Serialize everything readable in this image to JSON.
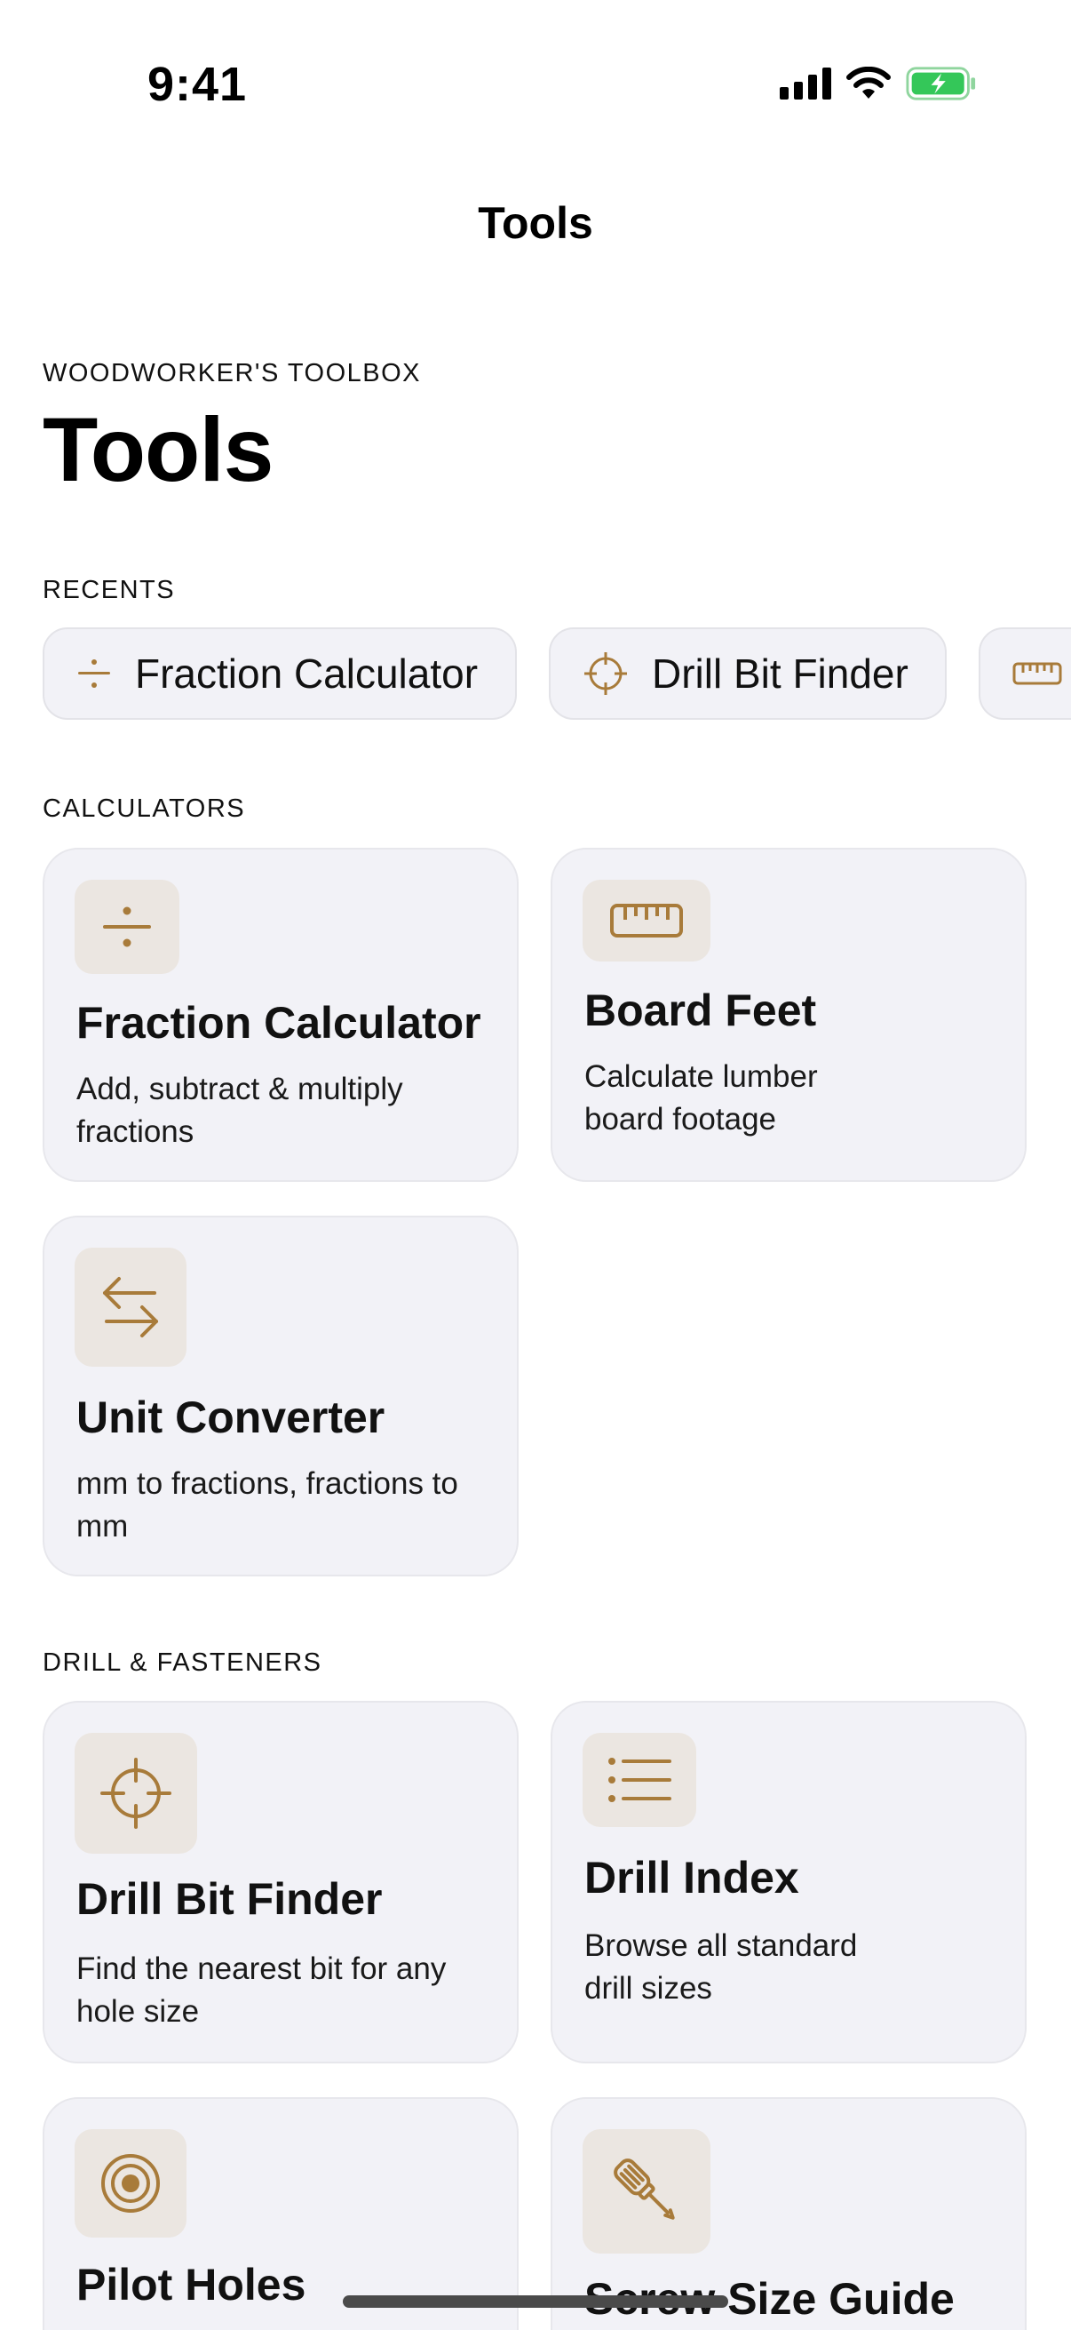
{
  "status_bar": {
    "time": "9:41"
  },
  "nav": {
    "title": "Tools"
  },
  "header": {
    "eyebrow": "WOODWORKER'S TOOLBOX",
    "title": "Tools"
  },
  "recents": {
    "section_label": "RECENTS",
    "items": [
      {
        "label": "Fraction Calculator",
        "icon": "divide-icon"
      },
      {
        "label": "Drill Bit Finder",
        "icon": "crosshair-icon"
      },
      {
        "label": "",
        "icon": "ruler-icon"
      }
    ]
  },
  "calculators": {
    "section_label": "CALCULATORS",
    "cards": [
      {
        "title": "Fraction Calculator",
        "subtitle": "Add, subtract & multiply fractions",
        "icon": "divide-icon"
      },
      {
        "title": "Board Feet",
        "subtitle": "Calculate lumber board footage",
        "icon": "ruler-icon"
      },
      {
        "title": "Unit Converter",
        "subtitle": "mm to fractions, fractions to mm",
        "icon": "arrows-exchange-icon"
      }
    ]
  },
  "drill": {
    "section_label": "DRILL & FASTENERS",
    "cards": [
      {
        "title": "Drill Bit Finder",
        "subtitle": "Find the nearest bit for any hole size",
        "icon": "crosshair-icon"
      },
      {
        "title": "Drill Index",
        "subtitle": "Browse all standard drill sizes",
        "icon": "list-icon"
      },
      {
        "title": "Pilot Holes",
        "subtitle": "",
        "icon": "target-icon"
      },
      {
        "title": "Screw Size Guide",
        "subtitle": "",
        "icon": "screwdriver-icon"
      }
    ]
  },
  "colors": {
    "accent": "#a87b3a",
    "card_bg": "#f2f2f7",
    "icon_bg": "#ebe6e1",
    "battery_green": "#34c759"
  }
}
